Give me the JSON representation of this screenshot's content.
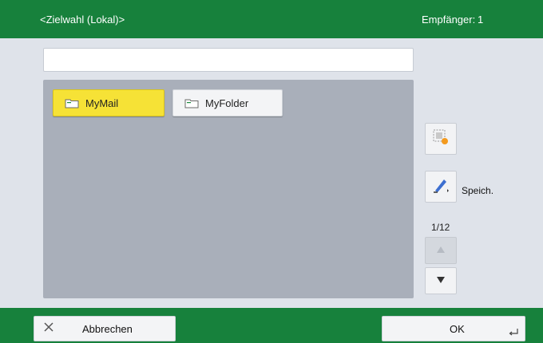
{
  "header": {
    "title": "<Zielwahl (Lokal)>",
    "recipients_label": "Empfänger:",
    "recipients_count": "1"
  },
  "search": {
    "value": "",
    "placeholder": ""
  },
  "entries": [
    {
      "label": "MyMail",
      "icon": "mail-folder-icon",
      "selected": true
    },
    {
      "label": "MyFolder",
      "icon": "folder-icon",
      "selected": false
    }
  ],
  "sidebar": {
    "store_label": "Speich.",
    "page_indicator": "1/12"
  },
  "footer": {
    "cancel_label": "Abbrechen",
    "ok_label": "OK"
  },
  "colors": {
    "header_green": "#17813c",
    "selected_yellow": "#f6e236",
    "panel_gray": "#a9afba"
  }
}
